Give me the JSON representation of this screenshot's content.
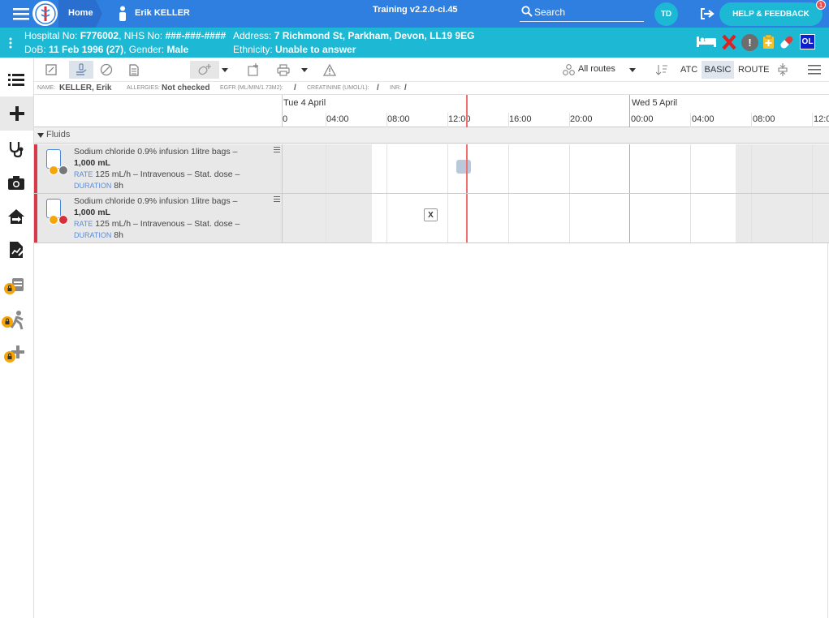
{
  "topbar": {
    "home_label": "Home",
    "patient_name": "Erik KELLER",
    "build_label": "Training v2.2.0-ci.45",
    "search_placeholder": "Search",
    "user_initials": "TD",
    "help_label": "HELP & FEEDBACK",
    "help_badge": "1",
    "colors": {
      "bar": "#2f7fe0",
      "info": "#1cb8d4"
    }
  },
  "infobar": {
    "hospital_prefix": "Hospital No:",
    "hospital_no": "F776002",
    "nhs_prefix": ", NHS No:",
    "nhs_no": "###-###-####",
    "address_prefix": "Address:",
    "address": "7 Richmond St, Parkham, Devon, LL19 9EG",
    "dob_prefix": "DoB:",
    "dob": "11 Feb 1996 (27)",
    "gender_prefix": ", Gender:",
    "gender": "Male",
    "ethnicity_prefix": "Ethnicity:",
    "ethnicity": "Unable to answer",
    "ol_badge": "OL"
  },
  "toolbar": {
    "routes_label": "All routes",
    "atc_label": "ATC",
    "basic_label": "BASIC",
    "route_label": "ROUTE"
  },
  "patient_strip": {
    "name_label": "NAME:",
    "name_value": "KELLER, Erik",
    "allergies_label": "ALLERGIES:",
    "allergies_value": "Not checked",
    "egfr_label": "EGFR (ML/MIN/1.73M2):",
    "egfr_value": "/",
    "creatinine_label": "CREATININE (UMOL/L):",
    "creatinine_value": "/",
    "inr_label": "INR:",
    "inr_value": "/"
  },
  "timeline": {
    "day1": "Tue 4 April",
    "day2": "Wed 5 April",
    "hours": [
      "0",
      "04:00",
      "08:00",
      "12:00",
      "16:00",
      "20:00",
      "00:00",
      "04:00",
      "08:00",
      "12:0"
    ]
  },
  "group": {
    "label": "Fluids"
  },
  "rows": [
    {
      "drug": "Sodium chloride 0.9% infusion 1litre bags –",
      "dose": "1,000 mL",
      "rate_label": "RATE",
      "rate": "125 mL/h – Intravenous – Stat. dose –",
      "duration_label": "DURATION",
      "duration": "8h"
    },
    {
      "drug": "Sodium chloride 0.9% infusion 1litre bags –",
      "dose": "1,000 mL",
      "rate_label": "RATE",
      "rate": "125 mL/h – Intravenous – Stat. dose –",
      "duration_label": "DURATION",
      "duration": "8h",
      "marker": "X"
    }
  ]
}
